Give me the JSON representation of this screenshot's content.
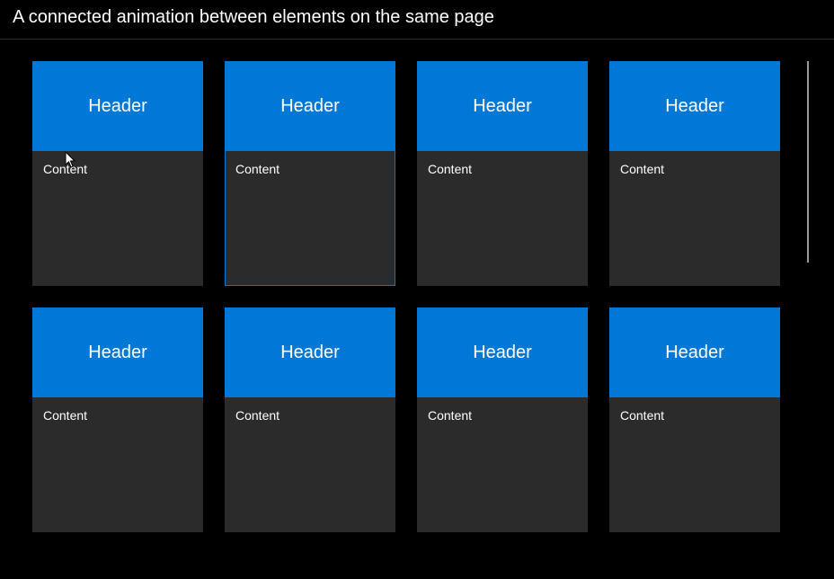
{
  "title": "A connected animation between elements on the same page",
  "cards": [
    {
      "header": "Header",
      "content": "Content",
      "selected": false
    },
    {
      "header": "Header",
      "content": "Content",
      "selected": true
    },
    {
      "header": "Header",
      "content": "Content",
      "selected": false
    },
    {
      "header": "Header",
      "content": "Content",
      "selected": false
    },
    {
      "header": "Header",
      "content": "Content",
      "selected": false
    },
    {
      "header": "Header",
      "content": "Content",
      "selected": false
    },
    {
      "header": "Header",
      "content": "Content",
      "selected": false
    },
    {
      "header": "Header",
      "content": "Content",
      "selected": false
    }
  ]
}
